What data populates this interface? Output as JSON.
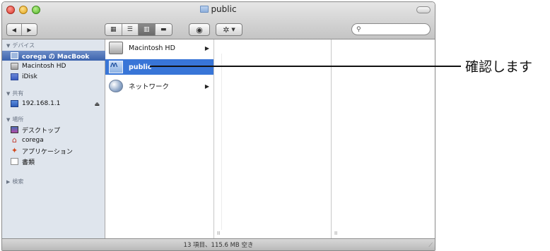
{
  "window": {
    "title": "public"
  },
  "toolbar": {
    "view_icons": [
      "icon-view-icon",
      "list-view-icon",
      "column-view-icon",
      "coverflow-view-icon"
    ],
    "active_view": "column",
    "quicklook_icon": "eye-icon",
    "action_icon": "gear-icon",
    "search": {
      "value": "",
      "placeholder": ""
    }
  },
  "sidebar": {
    "sections": [
      {
        "heading": "デバイス",
        "items": [
          {
            "label": "corega の MacBook",
            "icon": "macbook-icon",
            "selected": true
          },
          {
            "label": "Macintosh HD",
            "icon": "hard-drive-icon"
          },
          {
            "label": "iDisk",
            "icon": "idisk-icon"
          }
        ]
      },
      {
        "heading": "共有",
        "items": [
          {
            "label": "192.168.1.1",
            "icon": "network-server-icon",
            "eject": "⏏"
          }
        ]
      },
      {
        "heading": "場所",
        "items": [
          {
            "label": "デスクトップ",
            "icon": "desktop-icon"
          },
          {
            "label": "corega",
            "icon": "home-icon"
          },
          {
            "label": "アプリケーション",
            "icon": "applications-icon"
          },
          {
            "label": "書類",
            "icon": "documents-icon"
          }
        ]
      },
      {
        "heading": "検索",
        "items": []
      }
    ]
  },
  "columns": [
    {
      "items": [
        {
          "label": "Macintosh HD",
          "icon": "hard-drive-icon",
          "has_children": true
        },
        {
          "label": "public",
          "icon": "shared-folder-icon",
          "selected": true
        },
        {
          "label": "ネットワーク",
          "icon": "network-globe-icon",
          "has_children": true
        }
      ]
    },
    {
      "items": []
    },
    {
      "items": []
    }
  ],
  "status_bar": {
    "text": "13 項目、115.6 MB 空き"
  },
  "annotation": {
    "text": "確認します"
  }
}
